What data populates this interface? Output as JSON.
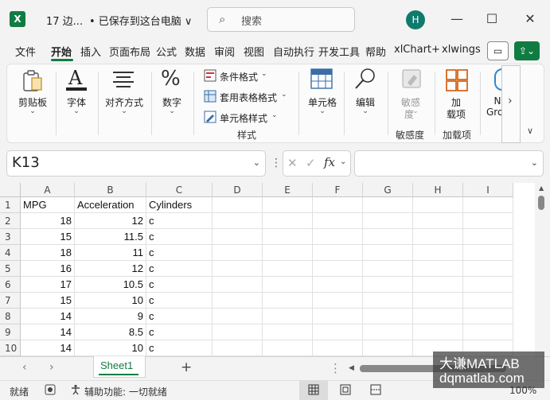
{
  "title": {
    "filename": "17 边...",
    "save_status": "• 已保存到这台电脑 ∨",
    "search_placeholder": "搜索",
    "avatar": "H"
  },
  "window_buttons": [
    "—",
    "☐",
    "✕"
  ],
  "tabs": [
    "文件",
    "开始",
    "插入",
    "页面布局",
    "公式",
    "数据",
    "审阅",
    "视图",
    "自动执行",
    "开发工具",
    "帮助",
    "xlChart+",
    "xlwings"
  ],
  "active_tab": "开始",
  "ribbon": {
    "clipboard": "剪贴板",
    "font": "字体",
    "alignment": "对齐方式",
    "number": "数字",
    "conditional_format": "条件格式",
    "table_format": "套用表格格式",
    "cell_style": "单元格样式",
    "styles_group": "样式",
    "cells": "单元格",
    "editing": "编辑",
    "sensitivity_1": "敏感",
    "sensitivity_2": "度",
    "sensitivity_group": "敏感度",
    "addins_1": "加",
    "addins_2": "载项",
    "addins_group": "加载项",
    "group_partial_1": "N",
    "group_partial_2": "Gro",
    "more": "›",
    "collapse": "∨"
  },
  "formula_bar": {
    "name_box": "K13",
    "fx": "fx",
    "formula": ""
  },
  "grid": {
    "columns": [
      "A",
      "B",
      "C",
      "D",
      "E",
      "F",
      "G",
      "H",
      "I"
    ],
    "row_numbers": [
      "1",
      "2",
      "3",
      "4",
      "5",
      "6",
      "7",
      "8",
      "9",
      "10"
    ],
    "rows": [
      [
        "MPG",
        "Acceleration",
        "Cylinders"
      ],
      [
        "18",
        "12",
        "c"
      ],
      [
        "15",
        "11.5",
        "c"
      ],
      [
        "18",
        "11",
        "c"
      ],
      [
        "16",
        "12",
        "c"
      ],
      [
        "17",
        "10.5",
        "c"
      ],
      [
        "15",
        "10",
        "c"
      ],
      [
        "14",
        "9",
        "c"
      ],
      [
        "14",
        "8.5",
        "c"
      ],
      [
        "14",
        "10",
        "c"
      ]
    ]
  },
  "sheets": [
    "Sheet1"
  ],
  "add_sheet": "+",
  "status": {
    "ready": "就绪",
    "accessibility": "辅助功能: 一切就绪",
    "zoom": "100%"
  },
  "watermark": {
    "line1": "大谦MATLAB",
    "line2": "dqmatlab.com"
  },
  "colors": {
    "accent": "#107c41"
  }
}
